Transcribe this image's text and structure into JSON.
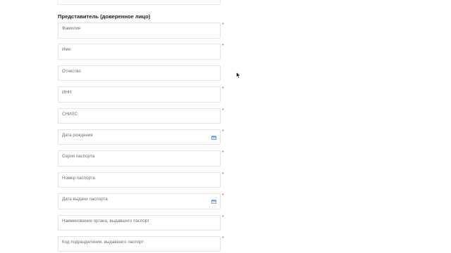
{
  "section": {
    "title": "Представитель (доверенное лицо)"
  },
  "fields": [
    {
      "label": "Фамилия",
      "required": "*"
    },
    {
      "label": "Имя",
      "required": "*"
    },
    {
      "label": "Отчество",
      "required": ""
    },
    {
      "label": "ИНН",
      "required": "*"
    },
    {
      "label": "СНИЛС",
      "required": "*"
    },
    {
      "label": "Дата рождения",
      "required": "*",
      "icon": "calendar-icon"
    },
    {
      "label": "Серия паспорта",
      "required": "*"
    },
    {
      "label": "Номер паспорта",
      "required": "*"
    },
    {
      "label": "Дата выдачи паспорта",
      "required": "*",
      "icon": "calendar-icon"
    },
    {
      "label": "Наименование органа, выдавшего паспорт",
      "required": "*"
    },
    {
      "label": "Код подразделения, выдавшего паспорт",
      "required": "*"
    }
  ],
  "colors": {
    "required": "#e53935",
    "icon": "#5b8fd6",
    "border": "#e3e3e3"
  }
}
